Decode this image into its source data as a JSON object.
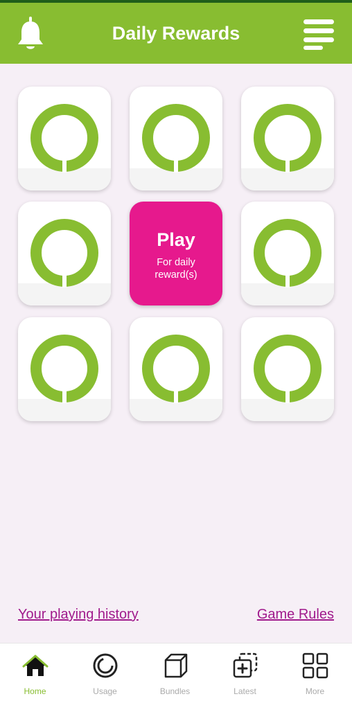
{
  "header": {
    "title": "Daily Rewards",
    "bell_icon": "bell-icon",
    "menu_icon": "menu-icon",
    "color": "#88bd31"
  },
  "grid": {
    "tile_icon": "ring-icon",
    "ring_color": "#88bd31",
    "play_tile": {
      "label": "Play",
      "sublabel": "For daily reward(s)",
      "color": "#e6198d"
    }
  },
  "links": {
    "history": "Your playing history",
    "rules": "Game Rules",
    "color": "#a01a8c"
  },
  "bottom_nav": {
    "items": [
      {
        "label": "Home",
        "icon": "home-icon",
        "active": true
      },
      {
        "label": "Usage",
        "icon": "usage-icon",
        "active": false
      },
      {
        "label": "Bundles",
        "icon": "box-icon",
        "active": false
      },
      {
        "label": "Latest",
        "icon": "latest-icon",
        "active": false
      },
      {
        "label": "More",
        "icon": "grid-icon",
        "active": false
      }
    ]
  }
}
